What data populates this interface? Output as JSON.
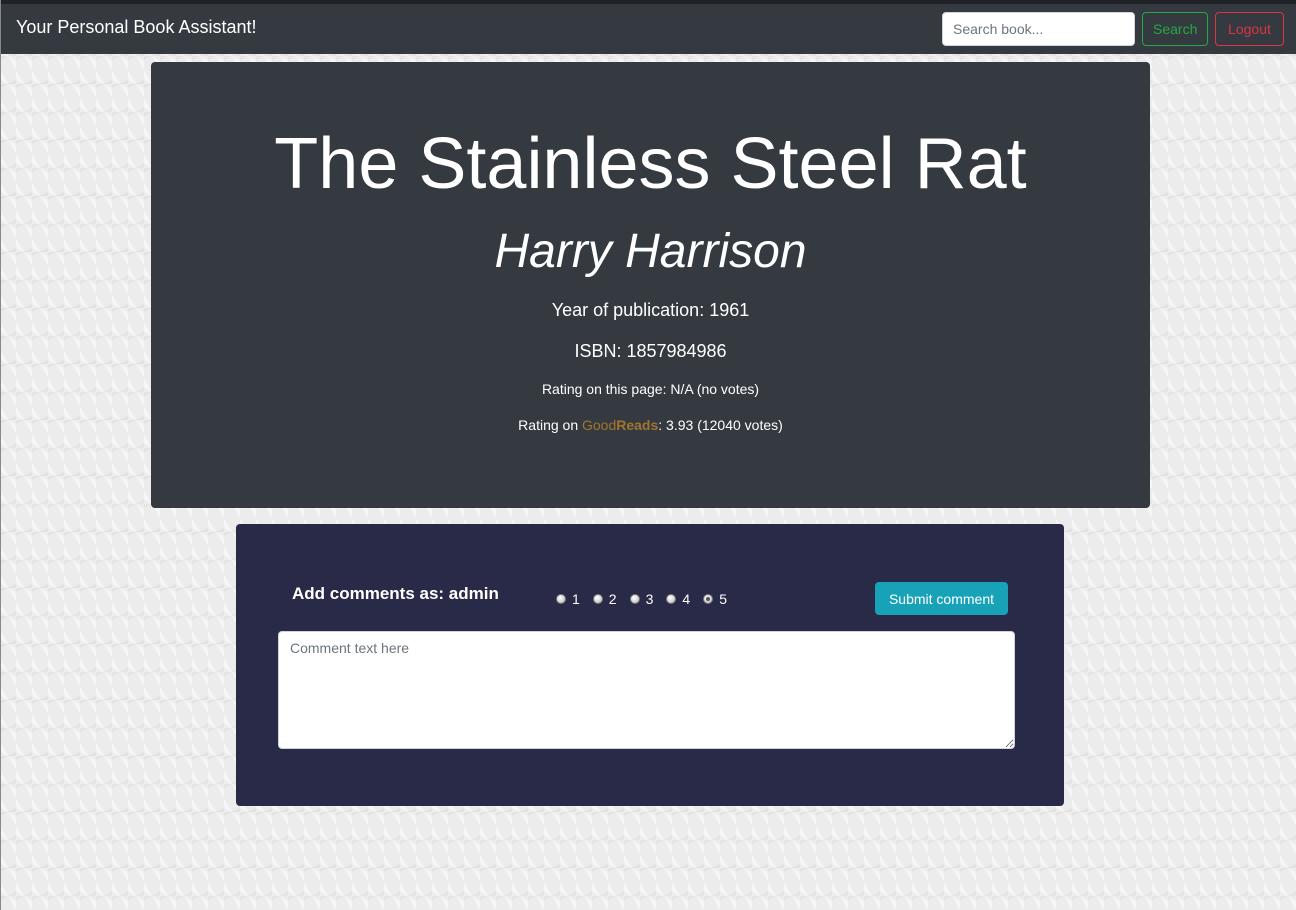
{
  "navbar": {
    "brand": "Your Personal Book Assistant!",
    "search_placeholder": "Search book...",
    "search_value": "",
    "search_label": "Search",
    "logout_label": "Logout"
  },
  "book": {
    "title": "The Stainless Steel Rat",
    "author": "Harry Harrison",
    "year_text": "Year of publication: 1961",
    "isbn_text": "ISBN: 1857984986",
    "rating_page_text": "Rating on this page: N/A (no votes)",
    "rating_gr_prefix": "Rating on ",
    "goodreads_good": "Good",
    "goodreads_reads": "Reads",
    "rating_gr_suffix": ": 3.93 (12040 votes)"
  },
  "comment": {
    "heading": "Add comments as: admin",
    "rating_options": [
      "1",
      "2",
      "3",
      "4",
      "5"
    ],
    "selected_rating": "5",
    "submit_label": "Submit comment",
    "text_placeholder": "Comment text here",
    "text_value": ""
  },
  "colors": {
    "navbar_bg": "#343a40",
    "book_card_bg": "#343a40",
    "comment_card_bg": "#292a48",
    "success": "#28a745",
    "danger": "#dc3545",
    "info": "#17a2b8",
    "goodreads": "#a1752e"
  }
}
